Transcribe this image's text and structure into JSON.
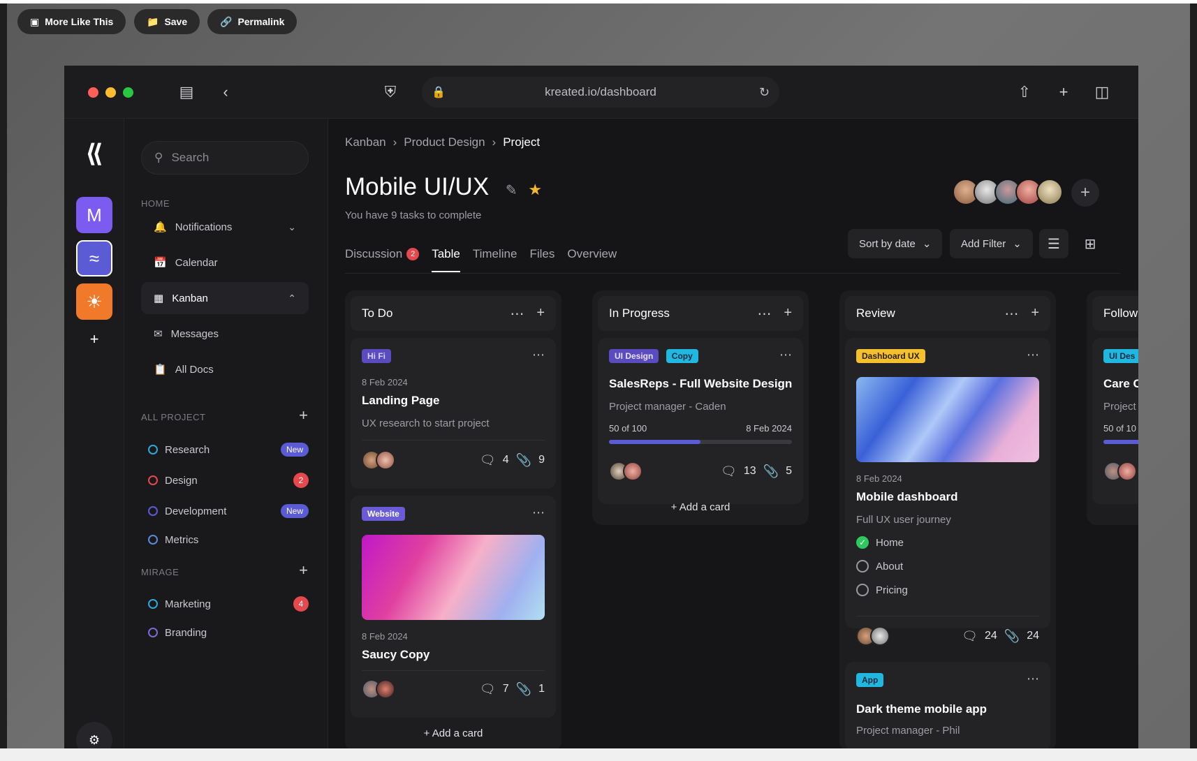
{
  "topbar": {
    "more_like_this": "More Like This",
    "save": "Save",
    "permalink": "Permalink"
  },
  "browser": {
    "url": "kreated.io/dashboard"
  },
  "rail": {
    "workspace_letter": "M"
  },
  "sidebar": {
    "search_placeholder": "Search",
    "home_label": "HOME",
    "nav": [
      {
        "label": "Notifications",
        "icon": "bell-icon"
      },
      {
        "label": "Calendar",
        "icon": "calendar-icon"
      },
      {
        "label": "Kanban",
        "icon": "kanban-icon"
      },
      {
        "label": "Messages",
        "icon": "mail-icon"
      },
      {
        "label": "All Docs",
        "icon": "docs-icon"
      }
    ],
    "all_project_label": "ALL PROJECT",
    "projects": [
      {
        "label": "Research",
        "badge": "New",
        "color": "#30a8d8"
      },
      {
        "label": "Design",
        "badge": "2",
        "color": "#e5484d"
      },
      {
        "label": "Development",
        "badge": "New",
        "color": "#5b5bd6"
      },
      {
        "label": "Metrics",
        "badge": "",
        "color": "#5b8bd6"
      }
    ],
    "mirage_label": "MIRAGE",
    "mirage": [
      {
        "label": "Marketing",
        "badge": "4",
        "color": "#30a8d8"
      },
      {
        "label": "Branding",
        "badge": "",
        "color": "#7b6bd6"
      }
    ]
  },
  "main": {
    "breadcrumb": [
      "Kanban",
      "Product Design",
      "Project"
    ],
    "title": "Mobile UI/UX",
    "subtitle": "You have 9 tasks to complete",
    "tabs": [
      {
        "label": "Discussion",
        "badge": "2"
      },
      {
        "label": "Table"
      },
      {
        "label": "Timeline"
      },
      {
        "label": "Files"
      },
      {
        "label": "Overview"
      }
    ],
    "sort_label": "Sort by date",
    "filter_label": "Add Filter",
    "add_card": "Add a card"
  },
  "columns": {
    "todo": {
      "title": "To Do",
      "cards": [
        {
          "tag": "Hi Fi",
          "date": "8 Feb 2024",
          "title": "Landing Page",
          "sub": "UX research to start project",
          "comments": "4",
          "attachments": "9"
        },
        {
          "tag": "Website",
          "date": "8 Feb 2024",
          "title": "Saucy Copy",
          "comments": "7",
          "attachments": "1"
        }
      ]
    },
    "progress": {
      "title": "In Progress",
      "cards": [
        {
          "tag1": "UI Design",
          "tag2": "Copy",
          "title": "SalesReps - Full Website Design",
          "sub": "Project manager - Caden",
          "progress_text": "50 of 100",
          "date": "8 Feb 2024",
          "progress": 0.5,
          "comments": "13",
          "attachments": "5"
        }
      ]
    },
    "review": {
      "title": "Review",
      "cards": [
        {
          "tag": "Dashboard UX",
          "date": "8 Feb 2024",
          "title": "Mobile dashboard",
          "sub": "Full UX user journey",
          "checklist": [
            "Home",
            "About",
            "Pricing"
          ],
          "comments": "24",
          "attachments": "24"
        },
        {
          "tag": "App",
          "title": "Dark theme mobile app",
          "sub": "Project manager - Phil"
        }
      ]
    },
    "follow": {
      "title": "Follow",
      "tag": "UI Des",
      "title_card": "Care C",
      "sub": "Project",
      "progress_text": "50 of 10"
    }
  },
  "colors": {
    "accent": "#5b5bd6",
    "danger": "#e5484d",
    "success": "#30c85e"
  }
}
